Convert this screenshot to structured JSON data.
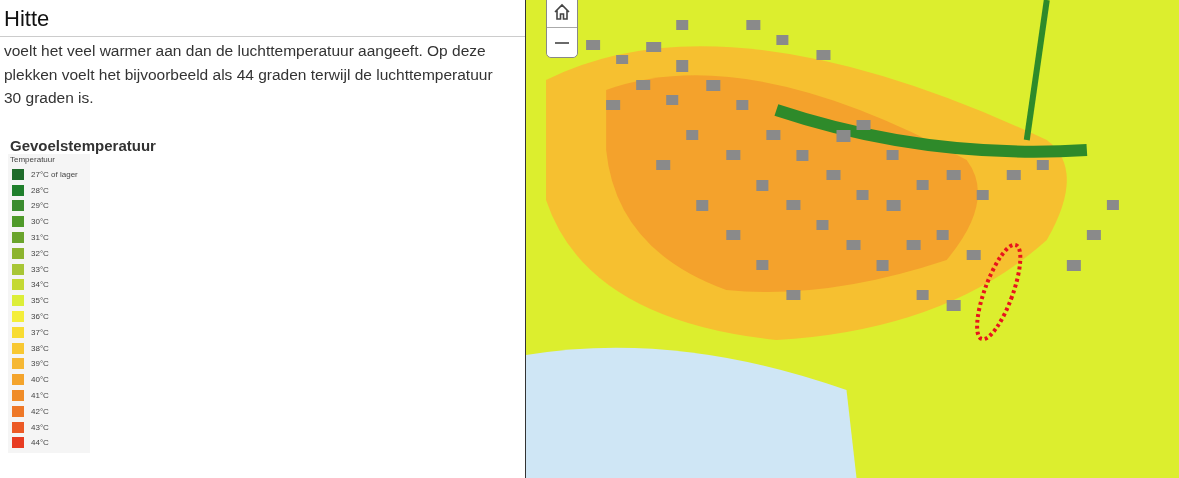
{
  "heading": "Hitte",
  "paragraph": "voelt het veel warmer aan dan de luchttemperatuur aangeeft. Op deze plekken voelt het bijvoorbeeld als 44 graden terwijl de luchttemperatuur 30 graden is.",
  "legend": {
    "title": "Gevoelstemperatuur",
    "subtitle": "Temperatuur",
    "items": [
      {
        "label": "27°C of lager",
        "color": "#1e6b2a"
      },
      {
        "label": "28°C",
        "color": "#1f7f2c"
      },
      {
        "label": "29°C",
        "color": "#3a8c2f"
      },
      {
        "label": "30°C",
        "color": "#4f9a2a"
      },
      {
        "label": "31°C",
        "color": "#6aa42c"
      },
      {
        "label": "32°C",
        "color": "#8cb42e"
      },
      {
        "label": "33°C",
        "color": "#a8c636"
      },
      {
        "label": "34°C",
        "color": "#c4d934"
      },
      {
        "label": "35°C",
        "color": "#dcee38"
      },
      {
        "label": "36°C",
        "color": "#f4ee3a"
      },
      {
        "label": "37°C",
        "color": "#f8dc32"
      },
      {
        "label": "38°C",
        "color": "#f8c832"
      },
      {
        "label": "39°C",
        "color": "#f6b834"
      },
      {
        "label": "40°C",
        "color": "#f4a42c"
      },
      {
        "label": "41°C",
        "color": "#f08c28"
      },
      {
        "label": "42°C",
        "color": "#ee7828"
      },
      {
        "label": "43°C",
        "color": "#ec5a26"
      },
      {
        "label": "44°C",
        "color": "#e83c22"
      }
    ]
  }
}
